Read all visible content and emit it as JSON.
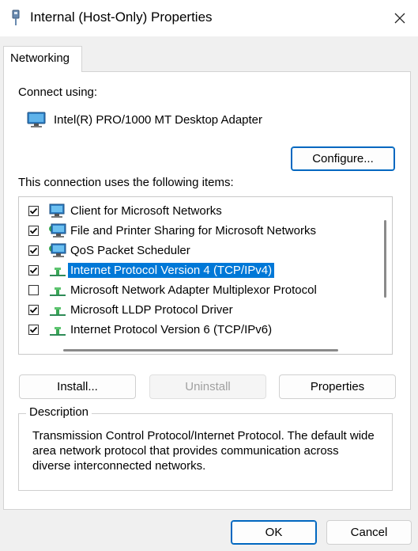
{
  "window": {
    "title": "Internal (Host-Only) Properties"
  },
  "tabs": [
    {
      "label": "Networking"
    }
  ],
  "connect_using": {
    "label": "Connect using:",
    "adapter": "Intel(R) PRO/1000 MT Desktop Adapter"
  },
  "buttons": {
    "configure": "Configure...",
    "install": "Install...",
    "uninstall": "Uninstall",
    "properties": "Properties",
    "ok": "OK",
    "cancel": "Cancel"
  },
  "items_label": "This connection uses the following items:",
  "items": [
    {
      "label": "Client for Microsoft Networks",
      "checked": true,
      "icon": "network-client-icon",
      "selected": false
    },
    {
      "label": "File and Printer Sharing for Microsoft Networks",
      "checked": true,
      "icon": "network-service-icon",
      "selected": false
    },
    {
      "label": "QoS Packet Scheduler",
      "checked": true,
      "icon": "network-service-icon",
      "selected": false
    },
    {
      "label": "Internet Protocol Version 4 (TCP/IPv4)",
      "checked": true,
      "icon": "protocol-icon",
      "selected": true
    },
    {
      "label": "Microsoft Network Adapter Multiplexor Protocol",
      "checked": false,
      "icon": "protocol-icon",
      "selected": false
    },
    {
      "label": "Microsoft LLDP Protocol Driver",
      "checked": true,
      "icon": "protocol-icon",
      "selected": false
    },
    {
      "label": "Internet Protocol Version 6 (TCP/IPv6)",
      "checked": true,
      "icon": "protocol-icon",
      "selected": false
    }
  ],
  "description": {
    "title": "Description",
    "text": "Transmission Control Protocol/Internet Protocol. The default wide area network protocol that provides communication across diverse interconnected networks."
  },
  "colors": {
    "selection": "#0078d7",
    "accent": "#0067c0"
  }
}
